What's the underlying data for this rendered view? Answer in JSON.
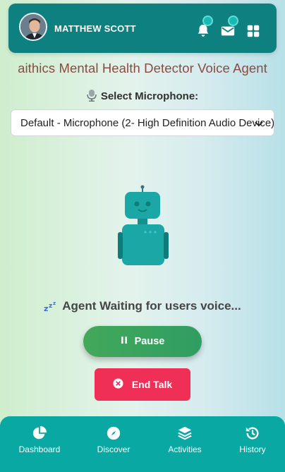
{
  "header": {
    "user_name": "MATTHEW SCOTT",
    "icons": [
      "bell-icon",
      "mail-icon",
      "grid-icon"
    ],
    "bg_color": "#0e8080"
  },
  "page_title": "aithics Mental Health Detector Voice Agent",
  "microphone": {
    "label": "Select Microphone:",
    "selected": "Default - Microphone (2- High Definition Audio Device)"
  },
  "agent": {
    "status": "Agent Waiting for users voice..."
  },
  "buttons": {
    "pause": "Pause",
    "end_talk": "End Talk"
  },
  "bottom_nav": {
    "items": [
      {
        "label": "Dashboard",
        "icon": "pie-chart-icon"
      },
      {
        "label": "Discover",
        "icon": "compass-icon"
      },
      {
        "label": "Activities",
        "icon": "layers-icon"
      },
      {
        "label": "History",
        "icon": "history-icon"
      }
    ],
    "bg_color": "#0aa8a2"
  },
  "colors": {
    "title": "#8a4b42",
    "pause": "#3aa35d",
    "end_talk": "#ef2f55",
    "robot": "#1aa7a5"
  }
}
